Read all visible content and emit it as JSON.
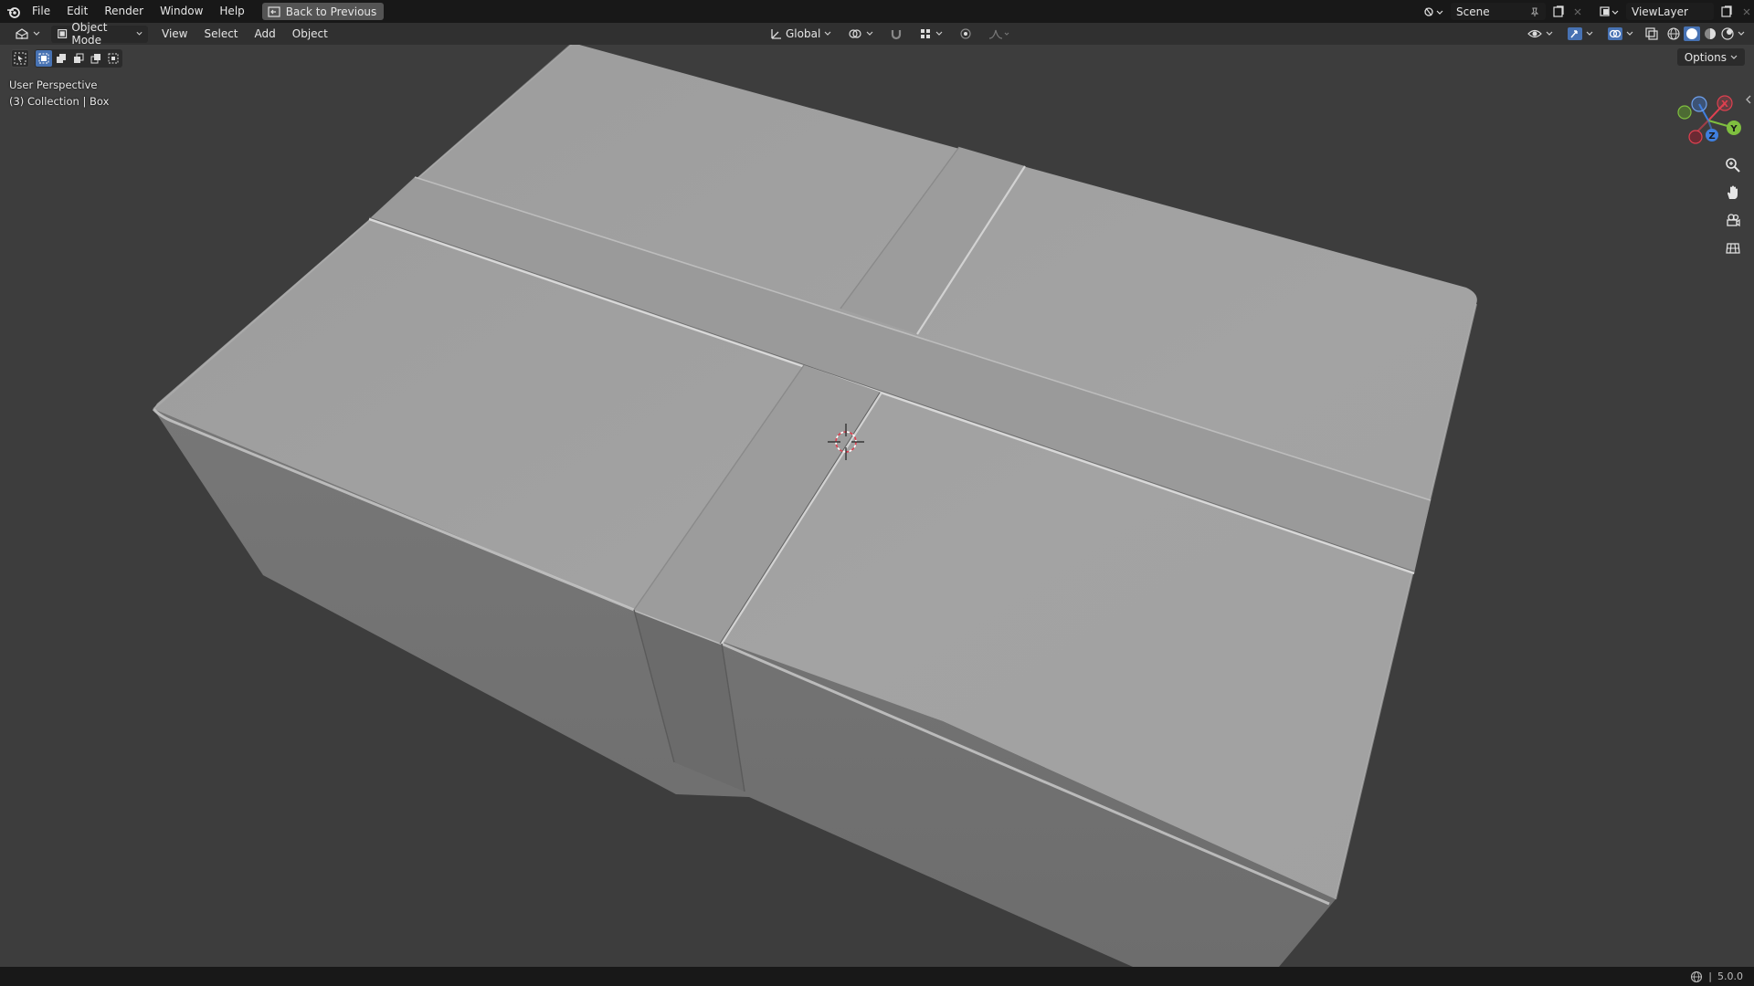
{
  "menu": {
    "items": [
      {
        "label": "File"
      },
      {
        "label": "Edit"
      },
      {
        "label": "Render"
      },
      {
        "label": "Window"
      },
      {
        "label": "Help"
      }
    ],
    "back_label": "Back to Previous"
  },
  "topright": {
    "scene": "Scene",
    "view_layer": "ViewLayer"
  },
  "header": {
    "mode": "Object Mode",
    "menus": [
      {
        "label": "View"
      },
      {
        "label": "Select"
      },
      {
        "label": "Add"
      },
      {
        "label": "Object"
      }
    ],
    "orientation": "Global"
  },
  "viewport": {
    "perspective": "User Perspective",
    "collection": "(3) Collection | Box",
    "options_label": "Options"
  },
  "gizmo": {
    "x_label": "X",
    "y_label": "Y",
    "z_label": "Z"
  },
  "status": {
    "version": "5.0.0"
  },
  "colors": {
    "accent": "#4772b3",
    "x_axis": "#e04050",
    "y_axis": "#7fbf3f",
    "z_axis": "#3f7fdf"
  }
}
